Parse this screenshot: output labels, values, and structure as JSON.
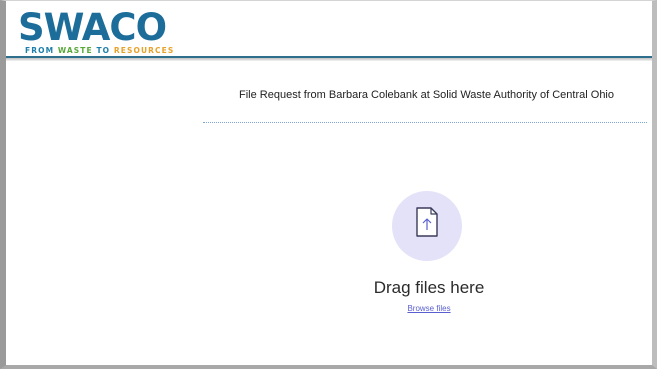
{
  "header": {
    "logo_text": "SWACO",
    "logo_tagline_part1": "FROM ",
    "logo_tagline_part2": "WASTE",
    "logo_tagline_part3": " TO ",
    "logo_tagline_part4": "RESOURCES"
  },
  "main": {
    "title": "File Request from Barbara Colebank at Solid Waste Authority of Central Ohio",
    "drop_label": "Drag files here",
    "browse_label": "Browse files",
    "upload_icon": "file-upload-icon"
  },
  "colors": {
    "brand_blue": "#1d6d9a",
    "brand_green": "#58a839",
    "brand_orange": "#e7a22b",
    "header_rule": "#2d6f8c",
    "upload_circle": "#e4e2f8",
    "link": "#5a5fcf"
  }
}
